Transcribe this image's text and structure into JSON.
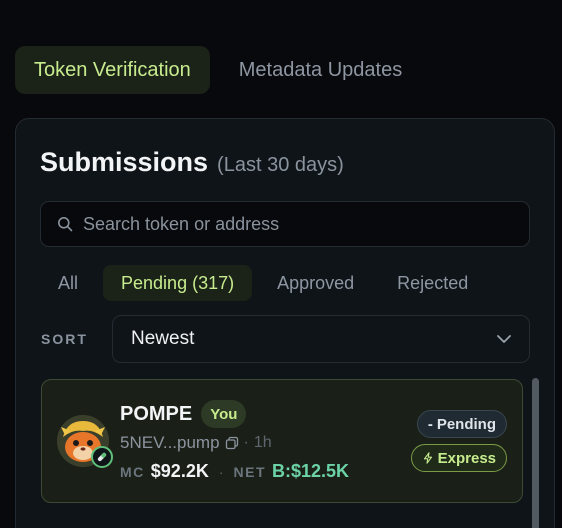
{
  "tabs": [
    {
      "label": "Token Verification",
      "active": true
    },
    {
      "label": "Metadata Updates",
      "active": false
    }
  ],
  "submissions": {
    "title": "Submissions",
    "subtitle": "(Last 30 days)",
    "search_placeholder": "Search token or address",
    "filters": [
      {
        "label": "All",
        "active": false
      },
      {
        "label": "Pending (317)",
        "active": true
      },
      {
        "label": "Approved",
        "active": false
      },
      {
        "label": "Rejected",
        "active": false
      }
    ],
    "sort_label": "SORT",
    "sort_value": "Newest"
  },
  "items": [
    {
      "name": "POMPE",
      "badge": "You",
      "address": "5NEV...pump",
      "age": "1h",
      "mc_label": "MC",
      "mc_value": "$92.2K",
      "net_label": "NET",
      "net_value": "B:$12.5K",
      "status": "Pending",
      "tier": "Express"
    }
  ],
  "colors": {
    "accent": "#c7ec8e",
    "background": "#07090c",
    "card": "#0f1419",
    "net_green": "#6cd3a6"
  },
  "icons": {
    "search": "search-icon",
    "chevron": "chevron-down-icon",
    "copy": "copy-icon",
    "bolt": "lightning-icon",
    "pill": "pill-icon"
  }
}
